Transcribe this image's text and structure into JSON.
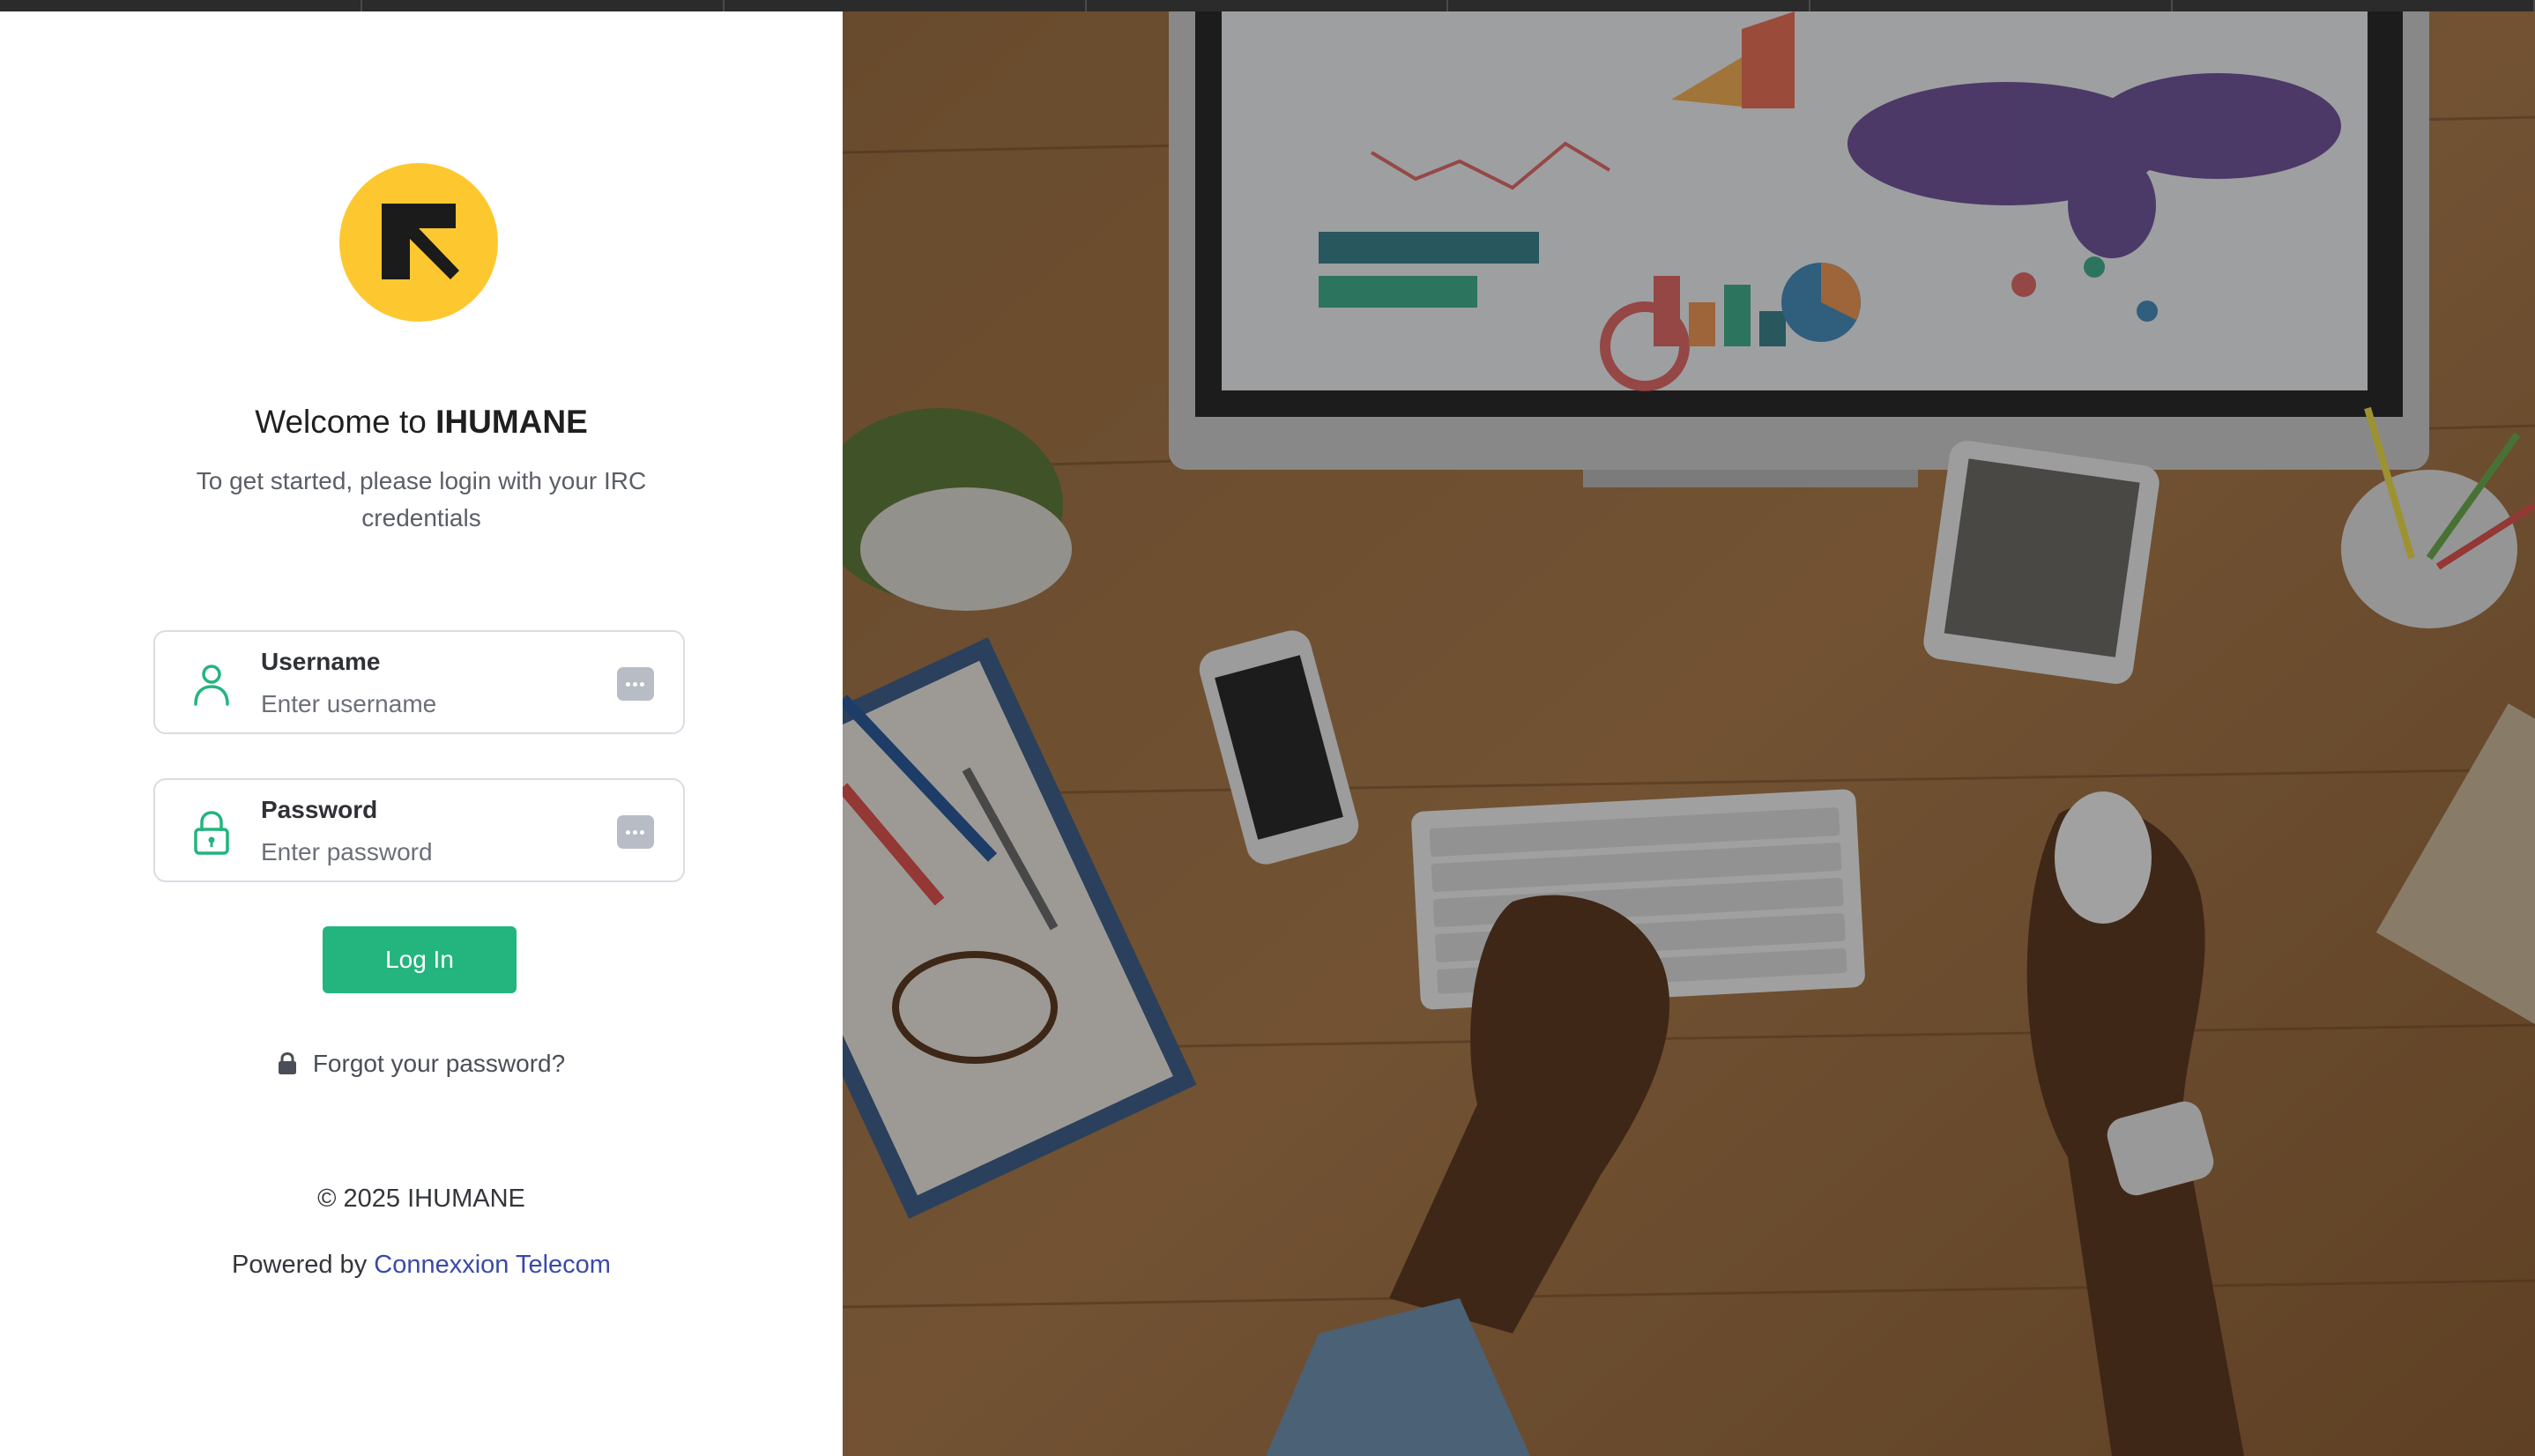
{
  "app": {
    "logo_icon": "arrow-up-left-logo",
    "welcome_prefix": "Welcome to ",
    "welcome_brand": "IHUMANE",
    "subtitle": "To get started, please login with your IRC credentials"
  },
  "form": {
    "username": {
      "label": "Username",
      "placeholder": "Enter username",
      "icon": "user-icon",
      "action_icon": "password-manager-icon"
    },
    "password": {
      "label": "Password",
      "placeholder": "Enter password",
      "icon": "lock-open-icon",
      "action_icon": "password-manager-icon"
    },
    "login_label": "Log In",
    "forgot_label": "Forgot your password?",
    "forgot_icon": "lock-icon"
  },
  "footer": {
    "copyright": "© 2025 IHUMANE",
    "powered_prefix": "Powered by ",
    "powered_link": "Connexxion Telecom"
  },
  "colors": {
    "brand_yellow": "#fdc82f",
    "primary_green": "#24b47e",
    "link_blue": "#3b4aa8"
  },
  "background_image": "overhead photo of a wooden desk with a computer monitor showing dashboard charts, keyboard, hands, phone, tablet and stationery"
}
